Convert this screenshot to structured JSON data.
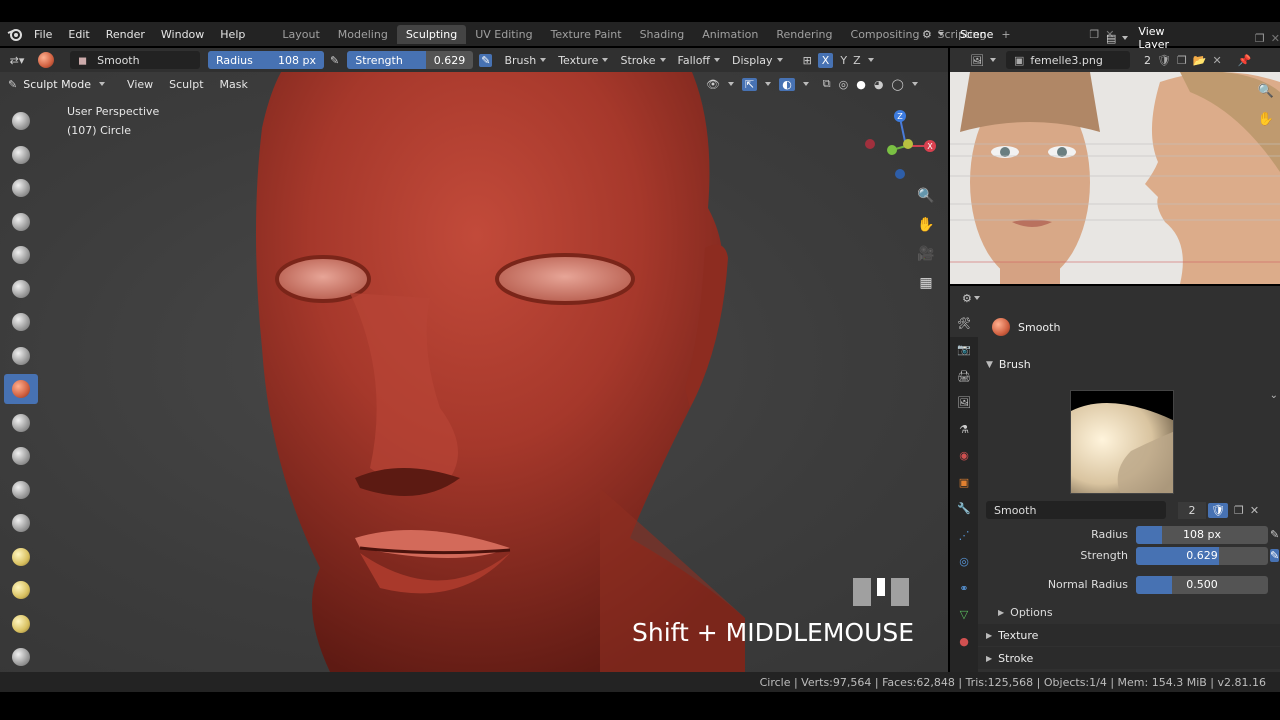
{
  "menu": [
    "File",
    "Edit",
    "Render",
    "Window",
    "Help"
  ],
  "workspaces": [
    "Layout",
    "Modeling",
    "Sculpting",
    "UV Editing",
    "Texture Paint",
    "Shading",
    "Animation",
    "Rendering",
    "Compositing",
    "Scripting"
  ],
  "active_workspace": "Sculpting",
  "scene": "Scene",
  "view_layer": "View Layer",
  "tool_header": {
    "brush_name": "Smooth",
    "radius_label": "Radius",
    "radius_value": "108 px",
    "strength_label": "Strength",
    "strength_value": "0.629",
    "strength_fraction": 0.629,
    "dropdowns": [
      "Brush",
      "Texture",
      "Stroke",
      "Falloff",
      "Display"
    ],
    "axes": [
      "X",
      "Y",
      "Z"
    ]
  },
  "mode_header": {
    "mode": "Sculpt Mode",
    "menus": [
      "View",
      "Sculpt",
      "Mask"
    ]
  },
  "viewport": {
    "perspective": "User Perspective",
    "object_info": "(107) Circle",
    "key_hint": "Shift + MIDDLEMOUSE",
    "gizmo_axes": [
      "X",
      "Y",
      "Z"
    ]
  },
  "image_editor": {
    "image_name": "femelle3.png",
    "users": "2"
  },
  "properties": {
    "brush_name": "Smooth",
    "panel_brush": "Brush",
    "datablock_name": "Smooth",
    "users": "2",
    "radius_label": "Radius",
    "radius_value": "108 px",
    "strength_label": "Strength",
    "strength_value": "0.629",
    "normal_radius_label": "Normal Radius",
    "normal_radius_value": "0.500",
    "options_label": "Options",
    "texture_label": "Texture",
    "stroke_label": "Stroke"
  },
  "status": {
    "text": "Circle | Verts:97,564 | Faces:62,848 | Tris:125,568 | Objects:1/4 | Mem: 154.3 MiB | v2.81.16"
  },
  "colors": {
    "accent": "#4772b3",
    "header": "#303030",
    "viewport_bg": "#3d3d3d",
    "skin": "#a8392c"
  }
}
